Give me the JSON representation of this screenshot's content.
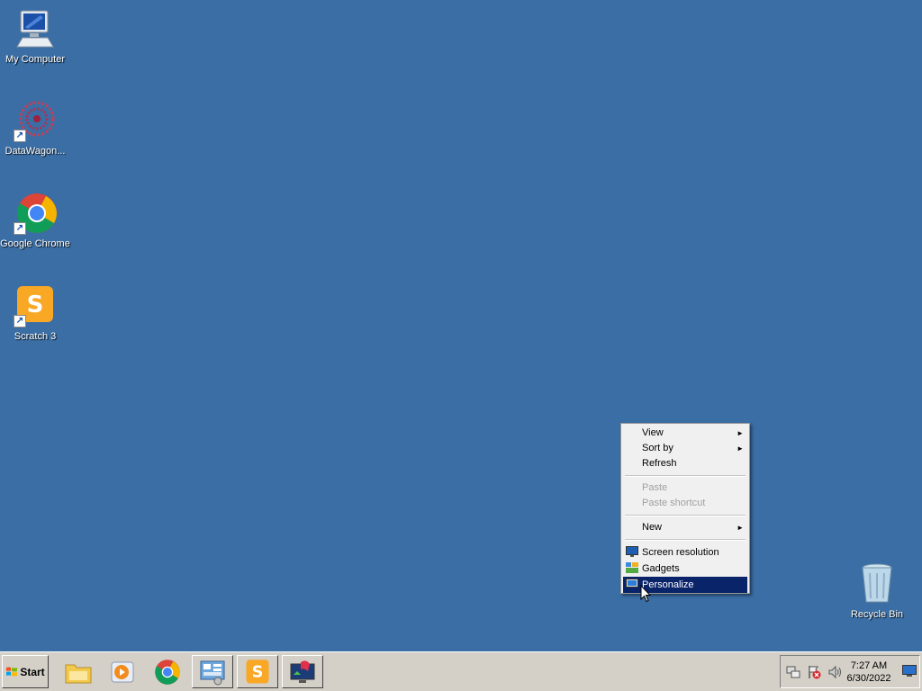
{
  "desktop": {
    "background": "#3a6ea5",
    "icons": [
      {
        "label": "My Computer",
        "icon": "my-computer-icon"
      },
      {
        "label": "DataWagon...",
        "icon": "datawagon-icon",
        "shortcut": true
      },
      {
        "label": "Google Chrome",
        "icon": "chrome-icon",
        "shortcut": true
      },
      {
        "label": "Scratch 3",
        "icon": "scratch-icon",
        "shortcut": true
      },
      {
        "label": "Recycle Bin",
        "icon": "recycle-bin-icon"
      }
    ]
  },
  "context_menu": {
    "items": [
      {
        "label": "View",
        "submenu": true
      },
      {
        "label": "Sort by",
        "submenu": true
      },
      {
        "label": "Refresh"
      },
      {
        "label": "Paste",
        "disabled": true
      },
      {
        "label": "Paste shortcut",
        "disabled": true
      },
      {
        "label": "New",
        "submenu": true
      },
      {
        "label": "Screen resolution",
        "icon": "screen-resolution-icon"
      },
      {
        "label": "Gadgets",
        "icon": "gadgets-icon"
      },
      {
        "label": "Personalize",
        "icon": "personalize-icon",
        "selected": true
      }
    ],
    "submenu_arrow": "►"
  },
  "taskbar": {
    "start_label": "Start",
    "buttons": [
      "file-explorer-icon",
      "media-player-icon",
      "chrome-icon",
      "control-panel-icon",
      "scratch-icon",
      "remote-desktop-icon"
    ],
    "tray": {
      "icons": [
        "network-icon",
        "action-center-icon",
        "volume-icon"
      ],
      "time": "7:27 AM",
      "date": "6/30/2022"
    }
  }
}
